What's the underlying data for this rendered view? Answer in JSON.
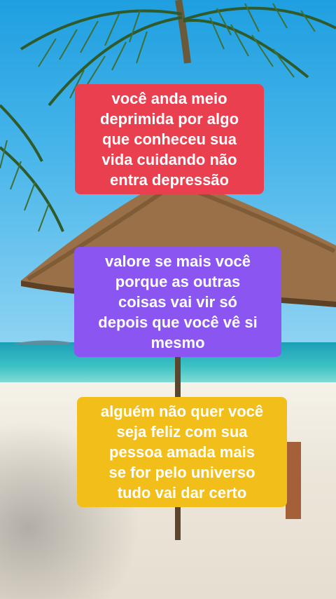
{
  "captions": [
    {
      "text": "você anda meio\ndeprimida por algo\nque conheceu sua\nvida cuidando não\nentra depressão",
      "color": "#ea3f4f"
    },
    {
      "text": "valore se mais você\nporque as outras\ncoisas vai vir só\ndepois que você vê si\nmesmo",
      "color": "#8a55f0"
    },
    {
      "text": "alguém não quer você\nseja feliz com sua\npessoa amada mais\nse for pelo universo\ntudo vai dar certo",
      "color": "#f2be1a"
    }
  ]
}
